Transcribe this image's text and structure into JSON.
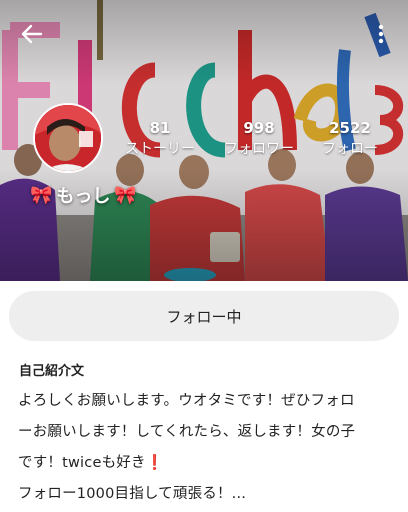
{
  "header": {
    "back_icon": "arrow-left-icon",
    "menu_icon": "more-vertical-icon",
    "cover_text": "Fischer's"
  },
  "profile": {
    "name": "もっし",
    "name_decoration": "🎀",
    "stats": [
      {
        "value": "81",
        "label": "ストーリー"
      },
      {
        "value": "998",
        "label": "フォロワー"
      },
      {
        "value": "2522",
        "label": "フォロー"
      }
    ]
  },
  "actions": {
    "follow_label": "フォロー中"
  },
  "bio": {
    "title": "自己紹介文",
    "line1": "よろしくお願いします。ウオタミです！ぜひフォロ",
    "line2": "ーお願いします！してくれたら、返します！女の子",
    "line3a": "です！twiceも好き",
    "line3b": "❗",
    "line4": "フォロー1000目指して頑張る！..."
  },
  "colors": {
    "follow_button_bg": "#eeeeee",
    "text": "#222222",
    "accent_red": "#d62828"
  }
}
